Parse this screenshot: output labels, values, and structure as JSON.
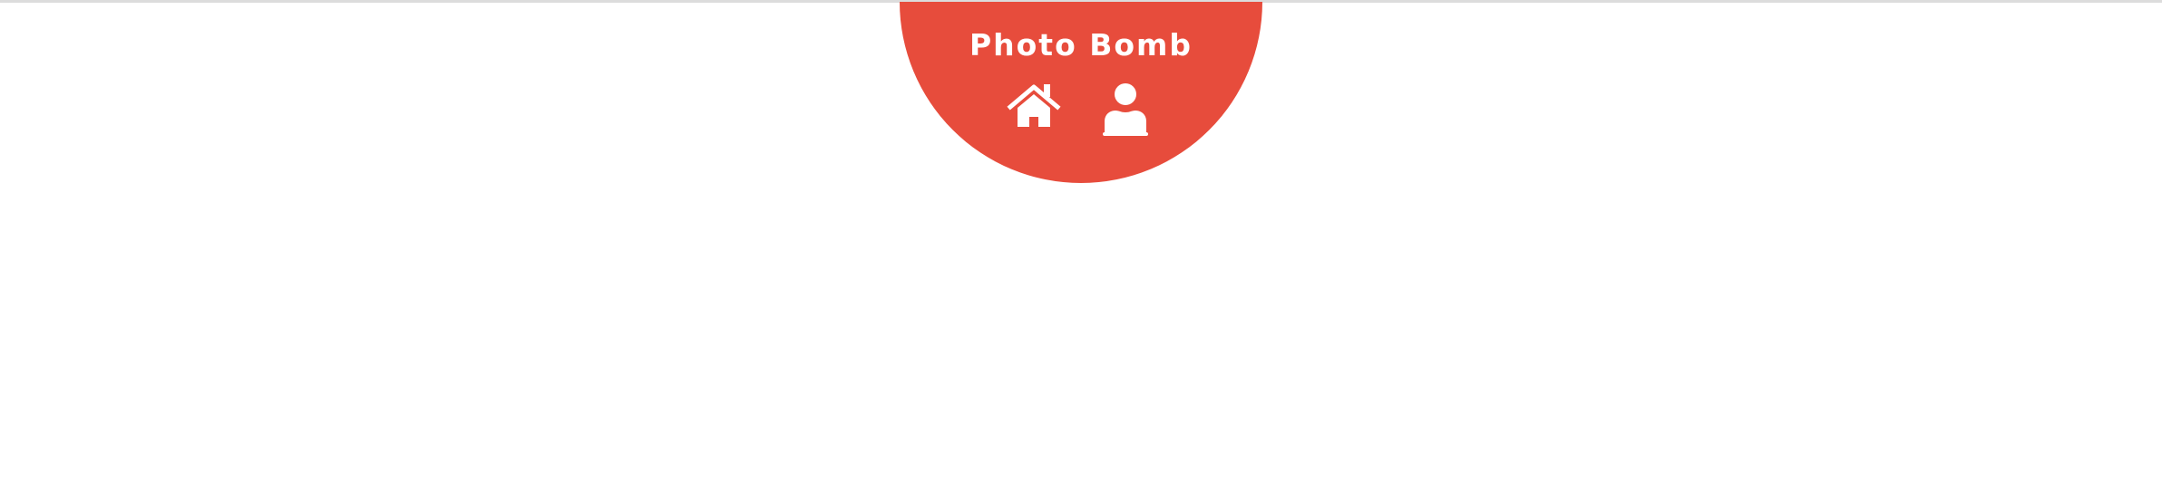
{
  "app": {
    "title": "Photo Bomb",
    "brand_color": "#e74c3c",
    "text_color": "#ffffff"
  },
  "nav": {
    "items": [
      {
        "icon": "home-icon"
      },
      {
        "icon": "user-icon"
      }
    ]
  }
}
